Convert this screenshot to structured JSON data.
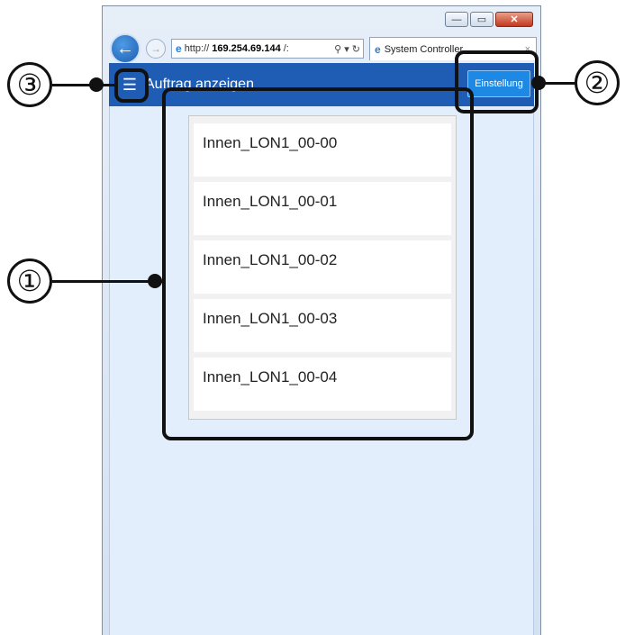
{
  "browser": {
    "url_prefix": "http://",
    "url_host": "169.254.69.144",
    "url_suffix": "/:",
    "addr_tools": "⚲ ▾ ↻",
    "tab_title": "System Controller",
    "back_glyph": "←",
    "forward_glyph": "→",
    "window_buttons": [
      "—",
      "▭",
      "✕"
    ]
  },
  "header": {
    "menu_glyph": "☰",
    "title": "Auftrag anzeigen",
    "settings_label": "Einstellung"
  },
  "orders": [
    "Innen_LON1_00-00",
    "Innen_LON1_00-01",
    "Innen_LON1_00-02",
    "Innen_LON1_00-03",
    "Innen_LON1_00-04"
  ],
  "callouts": [
    "①",
    "②",
    "③"
  ]
}
